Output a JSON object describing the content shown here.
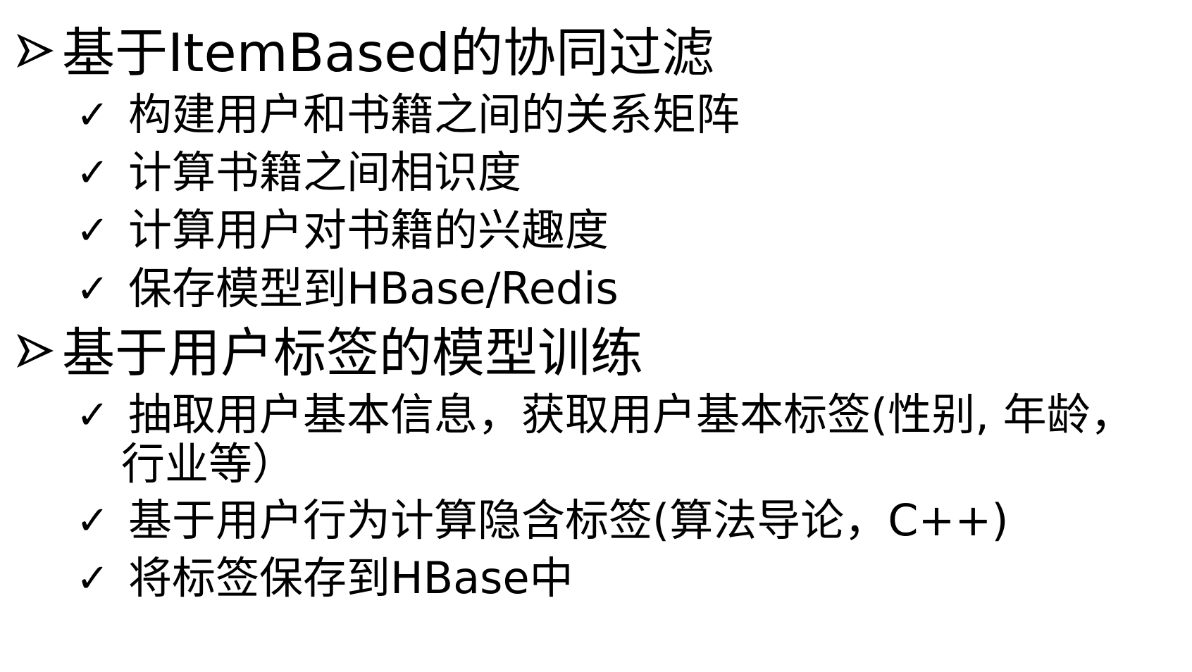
{
  "sections": [
    {
      "title": "基于ItemBased的协同过滤",
      "items": [
        "构建用户和书籍之间的关系矩阵",
        "计算书籍之间相识度",
        "计算用户对书籍的兴趣度",
        "保存模型到HBase/Redis"
      ]
    },
    {
      "title": "基于用户标签的模型训练",
      "items": [
        "抽取用户基本信息，获取用户基本标签(性别, 年龄，",
        "行业等）",
        "基于用户行为计算隐含标签(算法导论，C++)",
        "将标签保存到HBase中"
      ]
    }
  ],
  "icons": {
    "level1": "arrowhead-bullet-icon",
    "level2": "checkmark-bullet-icon"
  },
  "colors": {
    "text": "#000000",
    "background": "#ffffff"
  }
}
